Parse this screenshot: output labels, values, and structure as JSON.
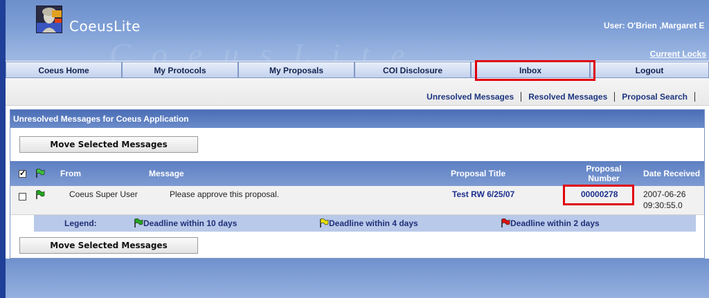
{
  "header": {
    "app_name": "CoeusLite",
    "user_label": "User: O'Brien ,Margaret E",
    "current_locks": "Current Locks",
    "watermark": "CoeusLite"
  },
  "nav": {
    "tabs": [
      {
        "label": "Coeus Home"
      },
      {
        "label": "My Protocols"
      },
      {
        "label": "My Proposals"
      },
      {
        "label": "COI Disclosure"
      },
      {
        "label": "Inbox"
      },
      {
        "label": "Logout"
      }
    ]
  },
  "subnav": {
    "unresolved": "Unresolved Messages",
    "resolved": "Resolved Messages",
    "search": "Proposal Search"
  },
  "panel": {
    "title": "Unresolved Messages for Coeus Application",
    "move_button": "Move Selected Messages"
  },
  "table": {
    "headers": {
      "from": "From",
      "message": "Message",
      "proposal_title": "Proposal Title",
      "proposal_number_1": "Proposal",
      "proposal_number_2": "Number",
      "date_received": "Date Received"
    },
    "rows": [
      {
        "from": "Coeus Super User",
        "message": "Please approve this proposal.",
        "proposal_title": "Test RW 6/25/07",
        "proposal_number": "00000278",
        "date_line1": "2007-06-26",
        "date_line2": "09:30:55.0"
      }
    ]
  },
  "legend": {
    "label": "Legend:",
    "items": [
      {
        "text": "Deadline within 10 days",
        "color": "#22a61e"
      },
      {
        "text": "Deadline within 4 days",
        "color": "#e6e000"
      },
      {
        "text": "Deadline within 2 days",
        "color": "#e01010"
      }
    ]
  },
  "icons": {
    "flag_header_color": "#3cc23a",
    "flag_row_color": "#22a61e"
  },
  "colors": {
    "highlight": "#e0000b",
    "link": "#1a2e8c"
  }
}
